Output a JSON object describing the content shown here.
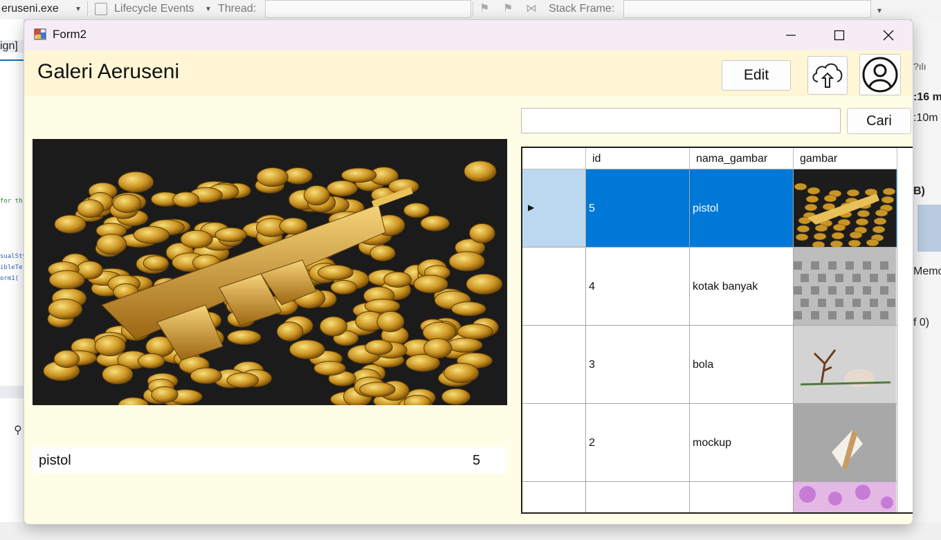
{
  "ide": {
    "process": "eruseni.exe",
    "lifecycle": "Lifecycle Events",
    "thread": "Thread:",
    "stack_frame": "Stack Frame:",
    "left_tab": "ign]",
    "code_lines": [
      " for th",
      "sualSty",
      "ibleTe",
      "orm1("
    ],
    "right_texts": [
      ":16 m",
      ":10m",
      "B)",
      "Memo",
      "f 0)"
    ]
  },
  "window": {
    "title": "Form2",
    "minimize": "—",
    "maximize": "☐",
    "close": "✕"
  },
  "header": {
    "title": "Galeri Aeruseni",
    "edit_label": "Edit"
  },
  "preview": {
    "selected_name": "pistol",
    "selected_id": "5"
  },
  "search": {
    "value": "",
    "button_label": "Cari"
  },
  "table": {
    "columns": [
      "id",
      "nama_gambar",
      "gambar"
    ],
    "rows": [
      {
        "id": "5",
        "nama_gambar": "pistol",
        "thumb": "gold-pistol"
      },
      {
        "id": "4",
        "nama_gambar": "kotak banyak",
        "thumb": "gray-boxes"
      },
      {
        "id": "3",
        "nama_gambar": "bola",
        "thumb": "tree-egg"
      },
      {
        "id": "2",
        "nama_gambar": "mockup",
        "thumb": "mockup-card"
      },
      {
        "id": "",
        "nama_gambar": "",
        "thumb": "pink-flowers"
      }
    ],
    "selected_index": 0
  },
  "colors": {
    "selection": "#0078d7",
    "selection_header": "#bcd8f1",
    "form_bg": "#fefee6",
    "header_bg": "#fff6d5"
  }
}
